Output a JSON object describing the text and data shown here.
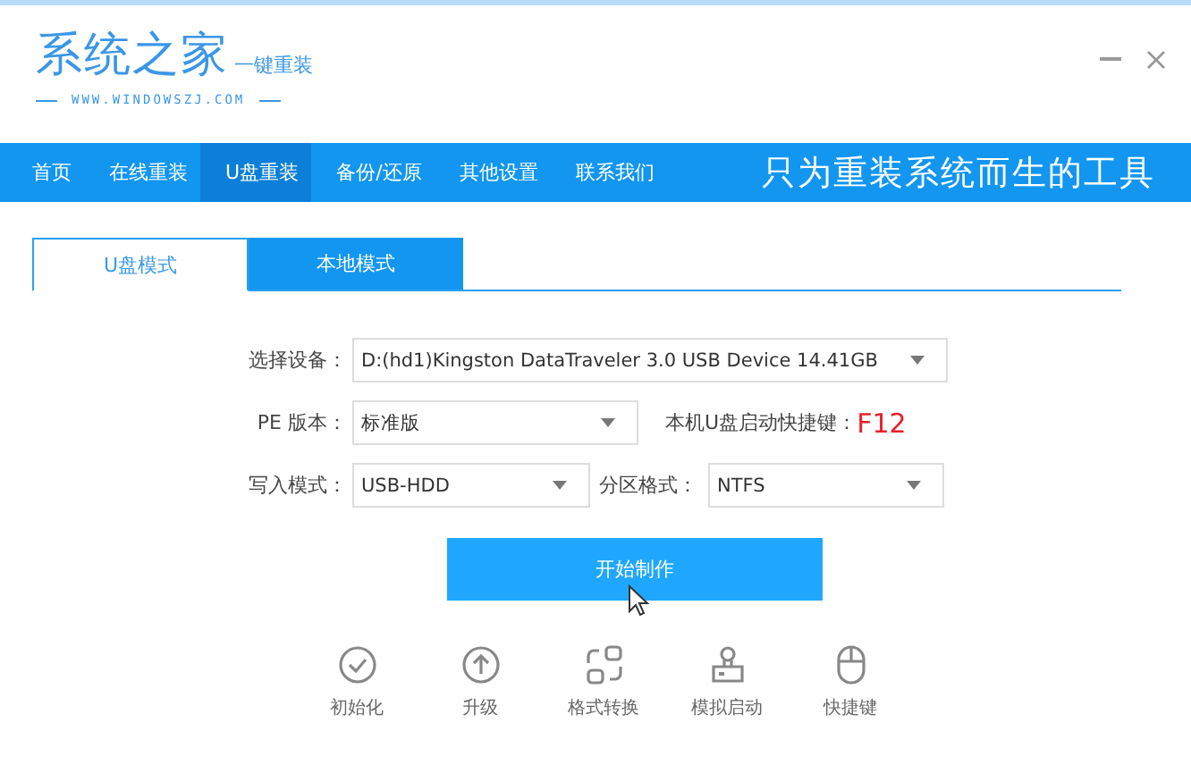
{
  "logo": {
    "title": "系统之家",
    "subtitle": "一键重装",
    "url": "WWW.WINDOWSZJ.COM"
  },
  "nav": {
    "items": [
      {
        "label": "首页",
        "selected": false
      },
      {
        "label": "在线重装",
        "selected": false
      },
      {
        "label": "U盘重装",
        "selected": true
      },
      {
        "label": "备份/还原",
        "selected": false
      },
      {
        "label": "其他设置",
        "selected": false
      },
      {
        "label": "联系我们",
        "selected": false
      }
    ],
    "slogan": "只为重装系统而生的工具"
  },
  "tabs": [
    {
      "label": "U盘模式",
      "selected": true
    },
    {
      "label": "本地模式",
      "selected": false
    }
  ],
  "form": {
    "device": {
      "label": "选择设备：",
      "value": "D:(hd1)Kingston DataTraveler 3.0 USB Device 14.41GB"
    },
    "pe_version": {
      "label": "PE 版本：",
      "value": "标准版"
    },
    "hotkey": {
      "label": "本机U盘启动快捷键：",
      "value": "F12"
    },
    "write_mode": {
      "label": "写入模式：",
      "value": "USB-HDD"
    },
    "partition_format": {
      "label": "分区格式：",
      "value": "NTFS"
    }
  },
  "start_button": "开始制作",
  "tools": [
    {
      "kind": "check",
      "label": "初始化"
    },
    {
      "kind": "upgrade",
      "label": "升级"
    },
    {
      "kind": "convert",
      "label": "格式转换"
    },
    {
      "kind": "stamp",
      "label": "模拟启动"
    },
    {
      "kind": "mouse",
      "label": "快捷键"
    }
  ]
}
